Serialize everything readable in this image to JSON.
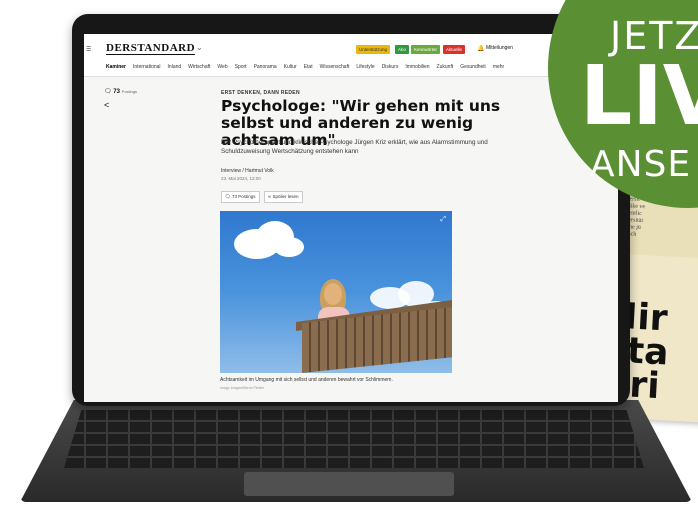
{
  "badge": {
    "line1": "JETZ",
    "line2": "LIV",
    "line3": "ANSE"
  },
  "newspaper": {
    "small_lines": [
      "Universit",
      "le Orüke ve",
      "tl öffentlic",
      "Universität",
      "ebname jü",
      "politisch"
    ],
    "big_lines": [
      "Hir",
      "sta",
      "bri"
    ]
  },
  "site": {
    "logo": "DERSTANDARD",
    "logo_chevron": "⌄",
    "pills": [
      {
        "label": "Unterstützung",
        "color": "#e8b80e"
      },
      {
        "label": "Abo",
        "color": "#2e9a3d"
      },
      {
        "label": "Kennwörter",
        "color": "#6aa93a"
      },
      {
        "label": "Aktuelle",
        "color": "#d9322e"
      }
    ],
    "mitteilungen": "Mitteilungen",
    "nav": [
      "Kaminer",
      "International",
      "Inland",
      "Wirtschaft",
      "Web",
      "Sport",
      "Panorama",
      "Kultur",
      "Etat",
      "Wissenschaft",
      "Lifestyle",
      "Diskurs",
      "Immobilien",
      "Zukunft",
      "Gesundheit",
      "mehr"
    ]
  },
  "article": {
    "postings_count": "73",
    "postings_label": "Postings",
    "kicker": "ERST DENKEN, DANN REDEN",
    "title": "Psychologe: \"Wir gehen mit uns selbst und anderen zu wenig achtsam um\"",
    "lead": "Der Psychotherapeut und klinische Psychologe Jürgen Kriz erklärt, wie aus Alarmstimmung und Schuldzuweisung Wertschätzung entstehen kann",
    "author": "Interview / Hartmut Volk",
    "date": "23. Mai 2024, 12:00",
    "btn_postings": "73 Postings",
    "btn_spoiler": "Spöiler lesen",
    "caption": "Achtsamkeit im Umgang mit sich selbst und anderen bewahrt vor Schlimmem.",
    "credit": "Imago Images/Bernd Fiedler"
  }
}
